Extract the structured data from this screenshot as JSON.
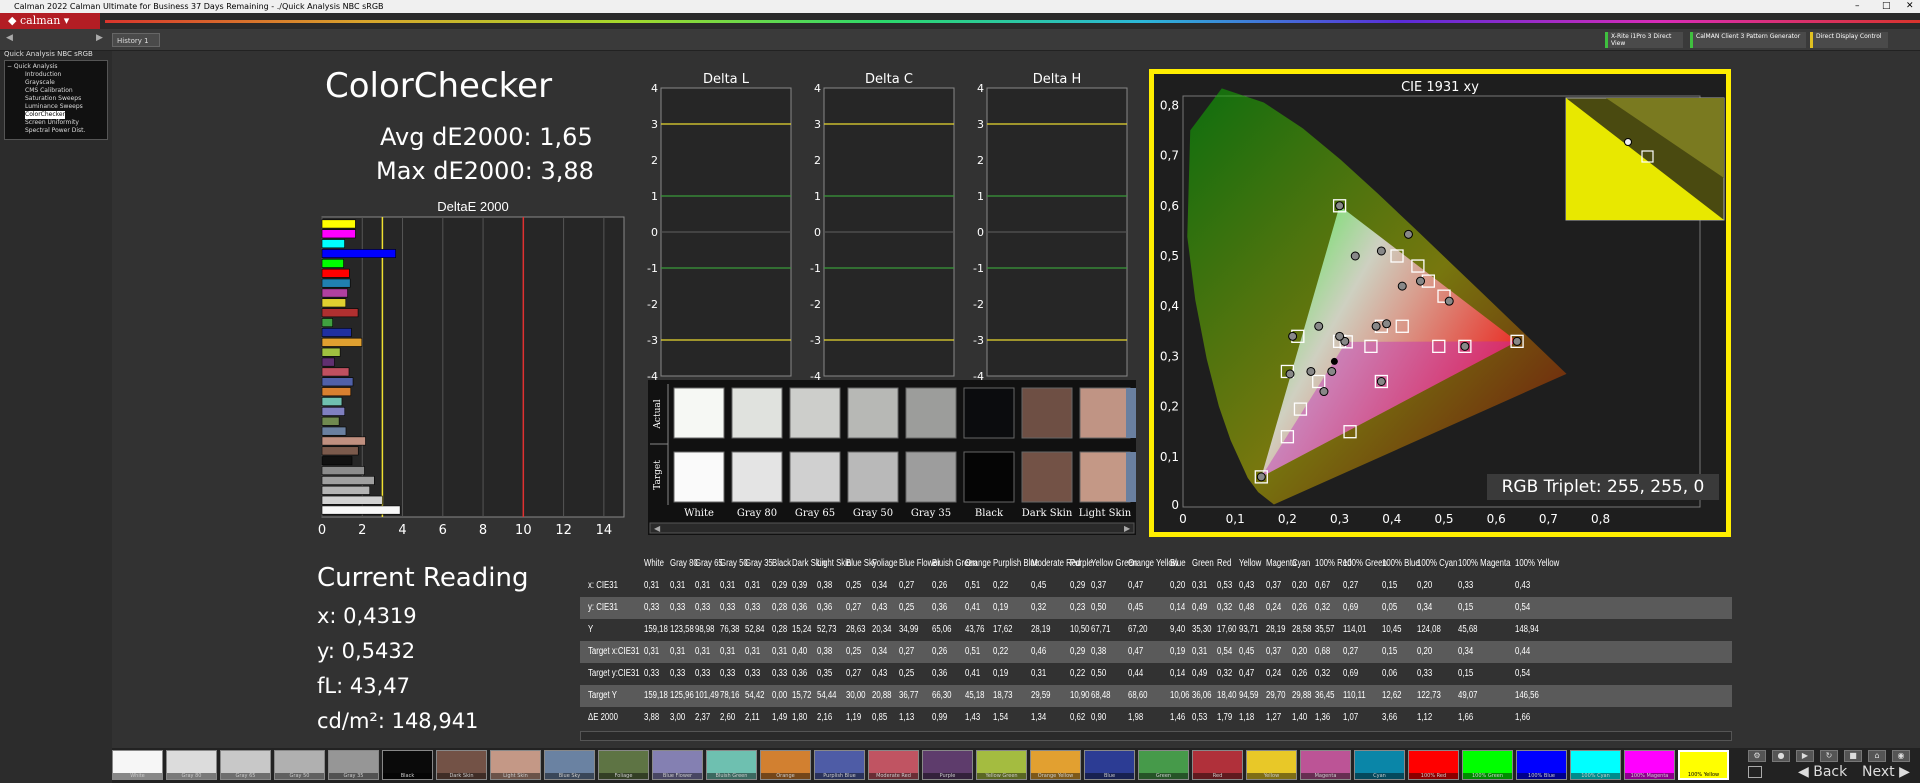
{
  "window": {
    "title": "Calman 2022 Calman Ultimate for Business 37 Days Remaining - ./Quick Analysis NBC sRGB"
  },
  "app": {
    "logo": "calman"
  },
  "tabs": [
    {
      "label": "History 1"
    }
  ],
  "devices": [
    {
      "label": "X-Rite i1Pro 3 Direct View",
      "color": "#3fbf3f"
    },
    {
      "label": "CalMAN Client 3 Pattern Generator",
      "color": "#3fbf3f"
    },
    {
      "label": "Direct Display Control",
      "color": "#e0c020"
    }
  ],
  "nav": {
    "title": "Quick Analysis NBC sRGB",
    "root": "Quick Analysis",
    "items": [
      "Introduction",
      "Grayscale",
      "CMS Calibration",
      "Saturation Sweeps",
      "Luminance Sweeps",
      "ColorChecker",
      "Screen Uniformity",
      "Spectral Power Dist."
    ],
    "selected": "ColorChecker"
  },
  "page": {
    "title": "ColorChecker",
    "avg": "Avg dE2000: 1,65",
    "max": "Max dE2000: 3,88"
  },
  "de_chart": {
    "title": "DeltaE 2000",
    "ticks": [
      "0",
      "2",
      "4",
      "6",
      "8",
      "10",
      "12",
      "14"
    ],
    "xmax": 15,
    "yellow_line": 3,
    "red_line": 10,
    "colors": [
      "#f8f8f8",
      "#d2d2d2",
      "#b4b4b4",
      "#a0a0a0",
      "#8c8c8c",
      "#111111",
      "#7b5a4c",
      "#c09080",
      "#6a80a0",
      "#708a50",
      "#8080c0",
      "#70c0b0",
      "#d88030",
      "#5060a8",
      "#c05060",
      "#603070",
      "#a0c040",
      "#e0a030",
      "#2030a0",
      "#40a040",
      "#b03030",
      "#e0d030",
      "#b040a0",
      "#2080b0",
      "#ff0000",
      "#00ff00",
      "#0000ff",
      "#00ffff",
      "#ff00ff",
      "#ffff00"
    ],
    "values": [
      3.88,
      3.0,
      2.37,
      2.6,
      2.11,
      1.49,
      1.8,
      2.16,
      1.19,
      0.85,
      1.13,
      0.99,
      1.43,
      1.54,
      1.34,
      0.62,
      0.9,
      1.98,
      1.46,
      0.53,
      1.79,
      1.18,
      1.27,
      1.4,
      1.36,
      1.07,
      3.66,
      1.12,
      1.66,
      1.66
    ]
  },
  "current": {
    "title": "Current Reading",
    "x": "x: 0,4319",
    "y": "y: 0,5432",
    "fl": "fL: 43,47",
    "cd": "cd/m²: 148,941"
  },
  "delta_charts": [
    {
      "title": "Delta L",
      "ticks": [
        "4",
        "3",
        "2",
        "1",
        "0",
        "-1",
        "-2",
        "-3",
        "-4"
      ]
    },
    {
      "title": "Delta C",
      "ticks": [
        "4",
        "3",
        "2",
        "1",
        "0",
        "-1",
        "-2",
        "-3",
        "-4"
      ]
    },
    {
      "title": "Delta H",
      "ticks": [
        "4",
        "3",
        "2",
        "1",
        "0",
        "-1",
        "-2",
        "-3",
        "-4"
      ]
    }
  ],
  "swatch_panel": {
    "actual_label": "Actual",
    "target_label": "Target",
    "items": [
      {
        "name": "White",
        "actual": "#f6f8f4",
        "target": "#fafafa"
      },
      {
        "name": "Gray 80",
        "actual": "#e0e2de",
        "target": "#e4e4e4"
      },
      {
        "name": "Gray 65",
        "actual": "#cdcecb",
        "target": "#d0d0d0"
      },
      {
        "name": "Gray 50",
        "actual": "#b7b8b5",
        "target": "#b9b9b9"
      },
      {
        "name": "Gray 35",
        "actual": "#9c9d9b",
        "target": "#9d9d9d"
      },
      {
        "name": "Black",
        "actual": "#0b0c0e",
        "target": "#050505"
      },
      {
        "name": "Dark Skin",
        "actual": "#6e4f44",
        "target": "#735246"
      },
      {
        "name": "Light Skin",
        "actual": "#c09484",
        "target": "#c49886"
      }
    ]
  },
  "cie": {
    "title": "CIE 1931 xy",
    "xticks": [
      "0",
      "0,1",
      "0,2",
      "0,3",
      "0,4",
      "0,5",
      "0,6",
      "0,7",
      "0,8"
    ],
    "yticks": [
      "0,1",
      "0,2",
      "0,3",
      "0,4",
      "0,5",
      "0,6",
      "0,7",
      "0,8"
    ],
    "extra_tick": "0",
    "triplet": "RGB Triplet: 255, 255, 0",
    "targets": [
      [
        0.64,
        0.33
      ],
      [
        0.3,
        0.6
      ],
      [
        0.15,
        0.06
      ],
      [
        0.3127,
        0.329
      ],
      [
        0.41,
        0.5
      ],
      [
        0.38,
        0.36
      ],
      [
        0.22,
        0.34
      ],
      [
        0.3,
        0.33
      ],
      [
        0.225,
        0.195
      ],
      [
        0.2,
        0.14
      ],
      [
        0.32,
        0.15
      ],
      [
        0.45,
        0.48
      ],
      [
        0.5,
        0.42
      ],
      [
        0.47,
        0.45
      ],
      [
        0.2,
        0.27
      ],
      [
        0.36,
        0.32
      ],
      [
        0.38,
        0.25
      ],
      [
        0.26,
        0.25
      ],
      [
        0.54,
        0.32
      ],
      [
        0.49,
        0.32
      ],
      [
        0.42,
        0.36
      ]
    ],
    "actuals": [
      [
        0.64,
        0.33
      ],
      [
        0.3,
        0.6
      ],
      [
        0.15,
        0.06
      ],
      [
        0.31,
        0.33
      ],
      [
        0.4319,
        0.5432
      ],
      [
        0.37,
        0.36
      ],
      [
        0.205,
        0.265
      ],
      [
        0.33,
        0.5
      ],
      [
        0.42,
        0.44
      ],
      [
        0.38,
        0.51
      ],
      [
        0.3,
        0.34
      ],
      [
        0.26,
        0.36
      ],
      [
        0.21,
        0.34
      ],
      [
        0.245,
        0.27
      ],
      [
        0.27,
        0.23
      ],
      [
        0.54,
        0.32
      ],
      [
        0.51,
        0.41
      ],
      [
        0.38,
        0.25
      ],
      [
        0.39,
        0.365
      ],
      [
        0.455,
        0.45
      ],
      [
        0.285,
        0.27
      ]
    ],
    "black": [
      0.29,
      0.29
    ],
    "inset_actual": [
      0.4,
      0.6
    ],
    "inset_target": [
      0.42,
      0.57
    ]
  },
  "table": {
    "columns": [
      "White",
      "Gray 80",
      "Gray 65",
      "Gray 50",
      "Gray 35",
      "Black",
      "Dark Skin",
      "Light Skin",
      "Blue Sky",
      "Foliage",
      "Blue Flower",
      "Bluish Green",
      "Orange",
      "Purplish Blue",
      "Moderate Red",
      "Purple",
      "Yellow Green",
      "Orange Yellow",
      "Blue",
      "Green",
      "Red",
      "Yellow",
      "Magenta",
      "Cyan",
      "100% Red",
      "100% Green",
      "100% Blue",
      "100% Cyan",
      "100% Magenta",
      "100% Yellow"
    ],
    "rows": [
      {
        "label": "x: CIE31",
        "values": [
          "0,31",
          "0,31",
          "0,31",
          "0,31",
          "0,31",
          "0,29",
          "0,39",
          "0,38",
          "0,25",
          "0,34",
          "0,27",
          "0,26",
          "0,51",
          "0,22",
          "0,45",
          "0,29",
          "0,37",
          "0,47",
          "0,20",
          "0,31",
          "0,53",
          "0,43",
          "0,37",
          "0,20",
          "0,67",
          "0,27",
          "0,15",
          "0,20",
          "0,33",
          "0,43"
        ]
      },
      {
        "label": "y: CIE31",
        "values": [
          "0,33",
          "0,33",
          "0,33",
          "0,33",
          "0,33",
          "0,28",
          "0,36",
          "0,36",
          "0,27",
          "0,43",
          "0,25",
          "0,36",
          "0,41",
          "0,19",
          "0,32",
          "0,23",
          "0,50",
          "0,45",
          "0,14",
          "0,49",
          "0,32",
          "0,48",
          "0,24",
          "0,26",
          "0,32",
          "0,69",
          "0,05",
          "0,34",
          "0,15",
          "0,54"
        ]
      },
      {
        "label": "Y",
        "values": [
          "159,18",
          "123,58",
          "98,98",
          "76,38",
          "52,84",
          "0,28",
          "15,24",
          "52,73",
          "28,63",
          "20,34",
          "34,99",
          "65,06",
          "43,76",
          "17,62",
          "28,19",
          "10,50",
          "67,71",
          "67,20",
          "9,40",
          "35,30",
          "17,60",
          "93,71",
          "28,19",
          "28,58",
          "35,57",
          "114,01",
          "10,45",
          "124,08",
          "45,68",
          "148,94"
        ]
      },
      {
        "label": "Target x:CIE31",
        "values": [
          "0,31",
          "0,31",
          "0,31",
          "0,31",
          "0,31",
          "0,31",
          "0,40",
          "0,38",
          "0,25",
          "0,34",
          "0,27",
          "0,26",
          "0,51",
          "0,22",
          "0,46",
          "0,29",
          "0,38",
          "0,47",
          "0,19",
          "0,31",
          "0,54",
          "0,45",
          "0,37",
          "0,20",
          "0,68",
          "0,27",
          "0,15",
          "0,20",
          "0,34",
          "0,44"
        ]
      },
      {
        "label": "Target y:CIE31",
        "values": [
          "0,33",
          "0,33",
          "0,33",
          "0,33",
          "0,33",
          "0,33",
          "0,36",
          "0,35",
          "0,27",
          "0,43",
          "0,25",
          "0,36",
          "0,41",
          "0,19",
          "0,31",
          "0,22",
          "0,50",
          "0,44",
          "0,14",
          "0,49",
          "0,32",
          "0,47",
          "0,24",
          "0,26",
          "0,32",
          "0,69",
          "0,06",
          "0,33",
          "0,15",
          "0,54"
        ]
      },
      {
        "label": "Target Y",
        "values": [
          "159,18",
          "125,96",
          "101,49",
          "78,16",
          "54,42",
          "0,00",
          "15,72",
          "54,44",
          "30,00",
          "20,88",
          "36,77",
          "66,30",
          "45,18",
          "18,73",
          "29,59",
          "10,90",
          "68,48",
          "68,60",
          "10,06",
          "36,06",
          "18,40",
          "94,59",
          "29,70",
          "29,88",
          "36,45",
          "110,11",
          "12,62",
          "122,73",
          "49,07",
          "146,56"
        ]
      },
      {
        "label": "ΔE 2000",
        "values": [
          "3,88",
          "3,00",
          "2,37",
          "2,60",
          "2,11",
          "1,49",
          "1,80",
          "2,16",
          "1,19",
          "0,85",
          "1,13",
          "0,99",
          "1,43",
          "1,54",
          "1,34",
          "0,62",
          "0,90",
          "1,98",
          "1,46",
          "0,53",
          "1,79",
          "1,18",
          "1,27",
          "1,40",
          "1,36",
          "1,07",
          "3,66",
          "1,12",
          "1,66",
          "1,66"
        ]
      }
    ]
  },
  "bottom_swatches": [
    {
      "name": "White",
      "color": "#f6f6f6"
    },
    {
      "name": "Gray 80",
      "color": "#dcdcdc"
    },
    {
      "name": "Gray 65",
      "color": "#c8c8c8"
    },
    {
      "name": "Gray 50",
      "color": "#b0b0b0"
    },
    {
      "name": "Gray 35",
      "color": "#969696"
    },
    {
      "name": "Black",
      "color": "#0a0a0a"
    },
    {
      "name": "Dark Skin",
      "color": "#735246"
    },
    {
      "name": "Light Skin",
      "color": "#c49886"
    },
    {
      "name": "Blue Sky",
      "color": "#6a82a2"
    },
    {
      "name": "Foliage",
      "color": "#5e7444"
    },
    {
      "name": "Blue Flower",
      "color": "#8480b2"
    },
    {
      "name": "Bluish Green",
      "color": "#6ec0b0"
    },
    {
      "name": "Orange",
      "color": "#d28030"
    },
    {
      "name": "Purplish Blue",
      "color": "#4e5ca6"
    },
    {
      "name": "Moderate Red",
      "color": "#c05462"
    },
    {
      "name": "Purple",
      "color": "#5e3c6c"
    },
    {
      "name": "Yellow Green",
      "color": "#a4bc40"
    },
    {
      "name": "Orange Yellow",
      "color": "#e2a030"
    },
    {
      "name": "Blue",
      "color": "#2c3c94"
    },
    {
      "name": "Green",
      "color": "#469a4a"
    },
    {
      "name": "Red",
      "color": "#b0303a"
    },
    {
      "name": "Yellow",
      "color": "#e8c828"
    },
    {
      "name": "Magenta",
      "color": "#bc5496"
    },
    {
      "name": "Cyan",
      "color": "#0a86a8"
    },
    {
      "name": "100% Red",
      "color": "#ff0000"
    },
    {
      "name": "100% Green",
      "color": "#00ff00"
    },
    {
      "name": "100% Blue",
      "color": "#0000ff"
    },
    {
      "name": "100% Cyan",
      "color": "#00ffff"
    },
    {
      "name": "100% Magenta",
      "color": "#ff00ff"
    },
    {
      "name": "100% Yellow",
      "color": "#ffff00"
    }
  ],
  "nav_buttons": {
    "back": "Back",
    "next": "Next"
  }
}
